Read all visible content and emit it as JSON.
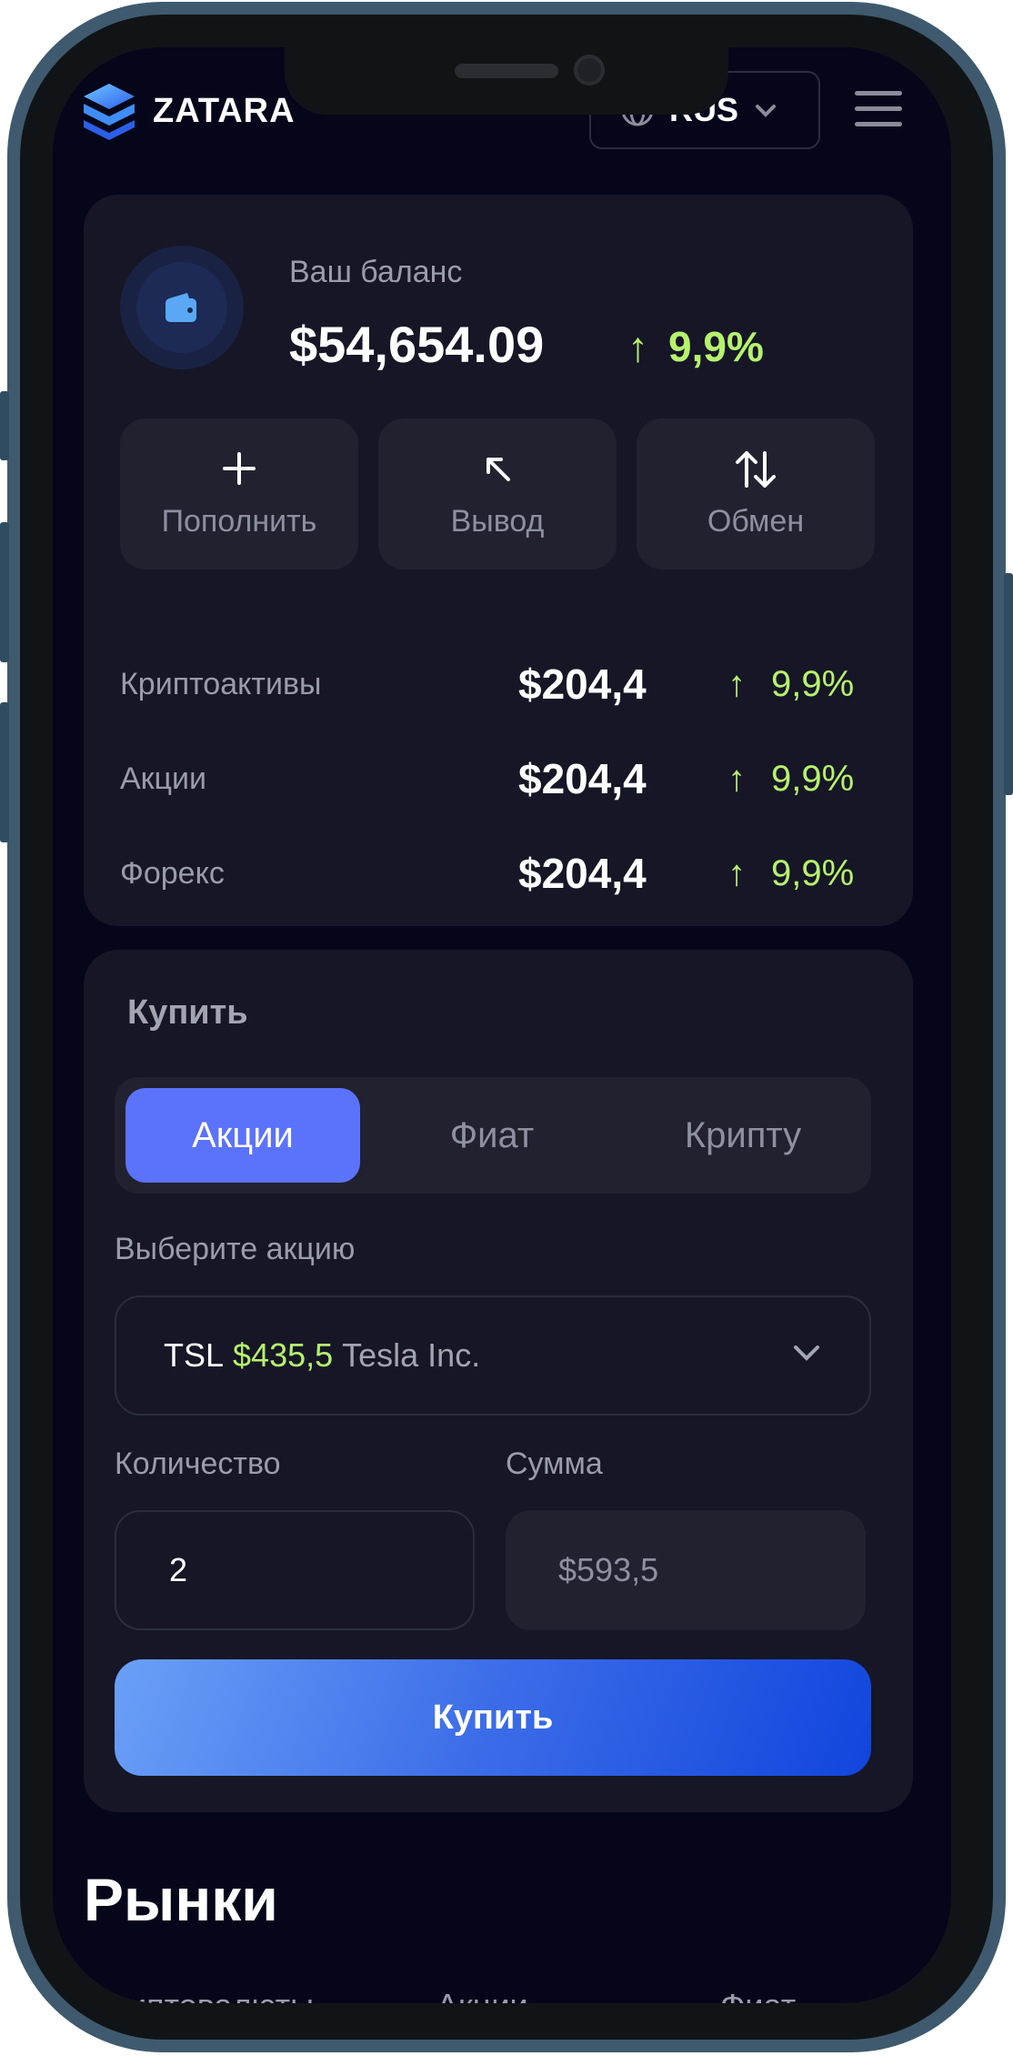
{
  "header": {
    "logo_text": "ZATARA",
    "language": "RUS"
  },
  "balance": {
    "label": "Ваш баланс",
    "value": "$54,654.09",
    "change": "9,9%"
  },
  "actions": [
    {
      "label": "Пополнить",
      "icon": "plus-icon"
    },
    {
      "label": "Вывод",
      "icon": "arrow-up-left-icon"
    },
    {
      "label": "Обмен",
      "icon": "swap-icon"
    }
  ],
  "assets": [
    {
      "name": "Криптоактивы",
      "value": "$204,4",
      "change": "9,9%"
    },
    {
      "name": "Акции",
      "value": "$204,4",
      "change": "9,9%"
    },
    {
      "name": "Форекс",
      "value": "$204,4",
      "change": "9,9%"
    }
  ],
  "buy": {
    "title": "Купить",
    "tabs": [
      "Акции",
      "Фиат",
      "Крипту"
    ],
    "active_tab": "Акции",
    "select_label": "Выберите акцию",
    "selected_ticker": "TSL",
    "selected_price": "$435,5",
    "selected_name": "Tesla Inc.",
    "qty_label": "Количество",
    "qty_value": "2",
    "sum_label": "Сумма",
    "sum_value": "$593,5",
    "button": "Купить"
  },
  "markets": {
    "title": "Рынки",
    "tabs": [
      "Криптовалюты",
      "Акции",
      "Фиат"
    ]
  },
  "colors": {
    "background": "#05061a",
    "card": "#161626",
    "accent": "#5b72fb",
    "positive": "#b6f26d"
  }
}
